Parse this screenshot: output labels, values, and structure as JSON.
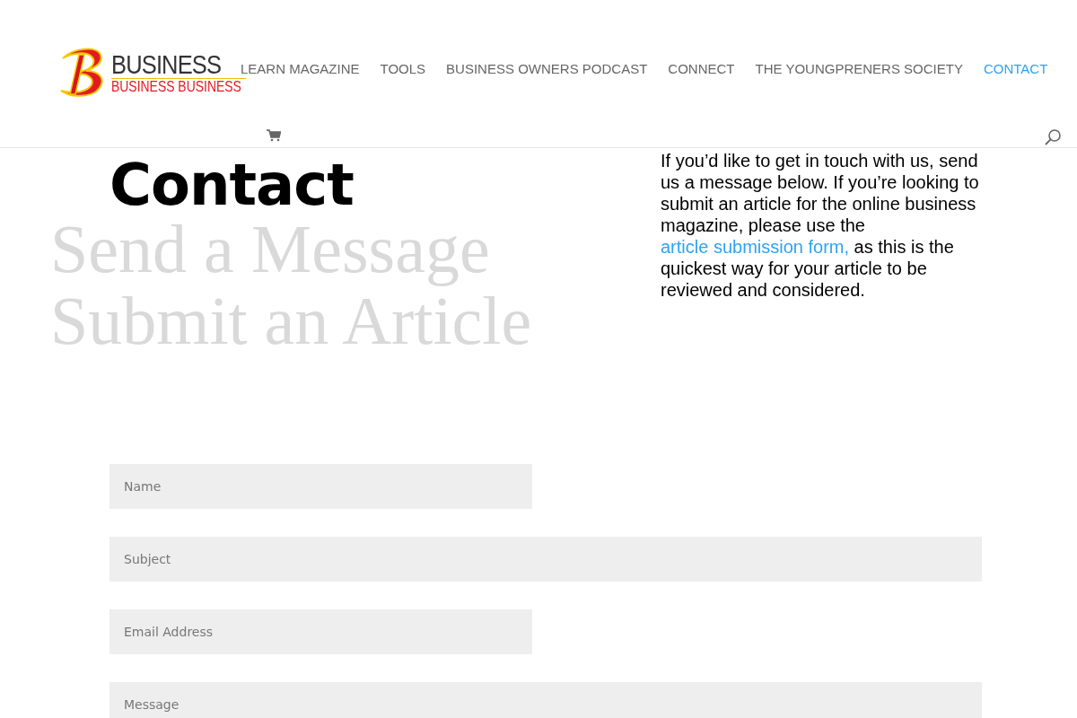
{
  "logo": {
    "title": "BUSINESS",
    "subtitle": "BUSINESS BUSINESS"
  },
  "nav": [
    {
      "label": "LEARN MAGAZINE",
      "selected": false
    },
    {
      "label": "TOOLS",
      "selected": false
    },
    {
      "label": "BUSINESS OWNERS PODCAST",
      "selected": false
    },
    {
      "label": "CONNECT",
      "selected": false
    },
    {
      "label": "THE YOUNGPRENERS SOCIETY",
      "selected": false
    },
    {
      "label": "CONTACT",
      "selected": true
    }
  ],
  "page_title": "Contact",
  "background_text": "Send a Message Submit an Article",
  "intro": {
    "before": "If you’d like to get in touch with us, send us a message below. If you’re looking to submit an article for the online business magazine, please use the ",
    "link": "article submission form,",
    "after": " as this is the quickest way for your article to be reviewed and considered."
  },
  "form": [
    {
      "placeholder": "Name",
      "kind": "half"
    },
    {
      "placeholder": "Subject",
      "kind": "full"
    },
    {
      "placeholder": "Email Address",
      "kind": "half"
    },
    {
      "placeholder": "Message",
      "kind": "full"
    }
  ]
}
